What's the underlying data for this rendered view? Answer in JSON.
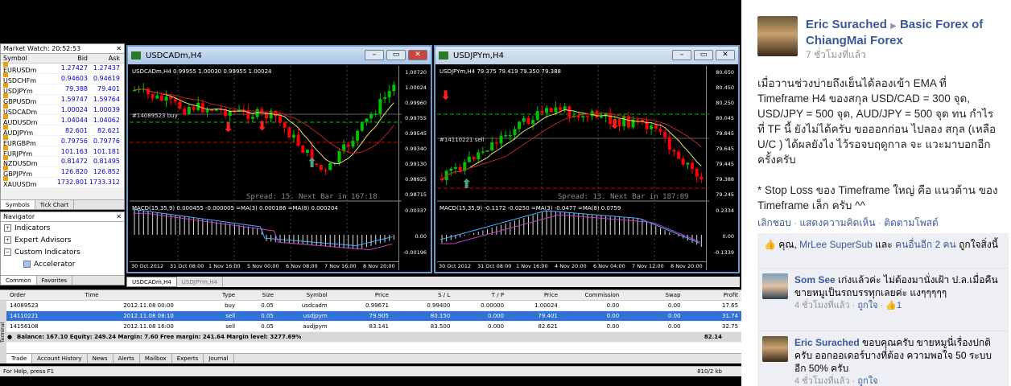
{
  "market_watch": {
    "title": "Market Watch: 20:52:53",
    "col_symbol": "Symbol",
    "col_bid": "Bid",
    "col_ask": "Ask",
    "rows": [
      {
        "symbol": "EURUSDm",
        "bid": "1.27427",
        "ask": "1.27437"
      },
      {
        "symbol": "USDCHFm",
        "bid": "0.94603",
        "ask": "0.94619"
      },
      {
        "symbol": "USDJPYm",
        "bid": "79.388",
        "ask": "79.401"
      },
      {
        "symbol": "GBPUSDm",
        "bid": "1.59747",
        "ask": "1.59764"
      },
      {
        "symbol": "USDCADm",
        "bid": "1.00024",
        "ask": "1.00039"
      },
      {
        "symbol": "AUDUSDm",
        "bid": "1.04044",
        "ask": "1.04062"
      },
      {
        "symbol": "AUDJPYm",
        "bid": "82.601",
        "ask": "82.621"
      },
      {
        "symbol": "EURGBPm",
        "bid": "0.79756",
        "ask": "0.79776"
      },
      {
        "symbol": "EURJPYm",
        "bid": "101.163",
        "ask": "101.181"
      },
      {
        "symbol": "NZDUSDm",
        "bid": "0.81472",
        "ask": "0.81495"
      },
      {
        "symbol": "GBPJPYm",
        "bid": "126.820",
        "ask": "126.852"
      },
      {
        "symbol": "XAUUSDm",
        "bid": "1732.801",
        "ask": "1733.312"
      }
    ],
    "tab_symbols": "Symbols",
    "tab_tick_chart": "Tick Chart"
  },
  "navigator": {
    "title": "Navigator",
    "items": [
      "Indicators",
      "Expert Advisors",
      "Custom Indicators",
      "Accelerator"
    ],
    "tab_common": "Common",
    "tab_favorites": "Favorites"
  },
  "chart1": {
    "window_title": "USDCADm,H4",
    "info": "USDCADm,H4  0.99955 1.00030 0.99955 1.00024",
    "order_label": "#14089523 buy",
    "spread": "Spread: 15. Next Bar in 167:18",
    "price_ticks": [
      "1.00720",
      "1.00024",
      "0.99960",
      "0.99755",
      "0.99545",
      "0.99340",
      "0.99130",
      "0.98925",
      "0.98715"
    ],
    "macd_label": "MACD(15,35,9) 0.000455 -0.000005  =MA(3) 0.000186  =MA(8) 0.000204",
    "macd_ticks": [
      "0.00337",
      "0.00",
      "-0.00196"
    ],
    "dates": [
      "30 Oct 2012",
      "31 Oct 08:00",
      "1 Nov 16:00",
      "5 Nov 00:00",
      "6 Nov 08:00",
      "7 Nov 16:00",
      "8 Nov 20:00"
    ]
  },
  "chart2": {
    "window_title": "USDJPYm,H4",
    "info": "USDJPYm,H4  79.375 79.419 79.350 79.388",
    "order_label": "#14110221 sell",
    "spread": "Spread: 13. Next Bar in 187:09",
    "price_ticks": [
      "80.650",
      "80.450",
      "80.250",
      "80.045",
      "79.845",
      "79.645",
      "79.445",
      "79.388",
      "79.245"
    ],
    "macd_label": "MACD(15,35,9) -0.1172 -0.0250  =MA(3) -0.0477  =MA(8) 0.0759",
    "macd_ticks": [
      "0.2334",
      "0.00",
      "-0.1339"
    ],
    "dates": [
      "30 Oct 2012",
      "31 Oct 08:00",
      "1 Nov 16:00",
      "4 Nov 20:00",
      "6 Nov 04:00",
      "7 Nov 12:00",
      "8 Nov 20:00"
    ]
  },
  "chart_tabs": [
    "USDCADm,H4",
    "USDJPYm,H4"
  ],
  "terminal": {
    "headers": [
      "Order",
      "Time",
      "Type",
      "Size",
      "Symbol",
      "Price",
      "S / L",
      "T / P",
      "Price",
      "Commission",
      "Swap",
      "Profit"
    ],
    "orders": [
      [
        "14089523",
        "2012.11.08 00:00",
        "buy",
        "0.05",
        "usdcadm",
        "0.99671",
        "0.99400",
        "0.00000",
        "1.00024",
        "0.00",
        "0.00",
        "17.65"
      ],
      [
        "14110221",
        "2012.11.08 08:10",
        "sell",
        "0.05",
        "usdjpym",
        "79.905",
        "80.150",
        "0.000",
        "79.401",
        "0.00",
        "0.00",
        "31.74"
      ],
      [
        "14156108",
        "2012.11.08 16:00",
        "sell",
        "0.05",
        "audjpym",
        "83.141",
        "83.500",
        "0.000",
        "82.621",
        "0.00",
        "0.00",
        "32.75"
      ]
    ],
    "balance_line": "Balance: 167.10  Equity: 249.24  Margin: 7.60  Free margin: 241.64  Margin level: 3277.69%",
    "balance_total": "82.14",
    "side_label": "Terminal",
    "tabs": [
      "Trade",
      "Account History",
      "News",
      "Alerts",
      "Mailbox",
      "Experts",
      "Journal"
    ]
  },
  "status": {
    "help": "For Help, press F1",
    "traffic": "810/2 kb"
  },
  "post": {
    "author": "Eric Surached",
    "separator": "▶",
    "group": "Basic Forex of ChiangMai Forex",
    "time": "7 ชั่วโมงที่แล้ว",
    "body1": "เมื่อวานช่วงบ่ายถึงเย็นได้ลองเข้า EMA ที่ Timeframe H4 ของสกุล USD/CAD = 300 จุด, USD/JPY = 500 จุด, AUD/JPY = 500 จุด ทน กำไรที่ TF นี้ ยังไม่ได้ครับ ขอออกก่อน ไปลอง สกุล (เหลือ U/C ) ได้ผลยังไง ไว้รอจบฤดูกาล จะ แวะมาบอกอีกครั้งครับ",
    "body2": "* Stop Loss ของ Timeframe ใหญ่ คือ แนวต้าน ของ Timeframe เล็ก ครับ ^^",
    "actions": [
      "เลิกชอบ",
      "แสดงความคิดเห็น",
      "ติดตามโพสต์"
    ],
    "likes_prefix": "คุณ, ",
    "likes_name": "MrLee SuperSub",
    "likes_and": " และ ",
    "likes_others": "คนอื่นอีก 2 คน",
    "likes_suffix": " ถูกใจสิ่งนี้"
  },
  "comments": [
    {
      "author": "Som See",
      "text": "เก่งแล้วค่ะ ไม่ต้องมานั่งเฝ้า ป.ล.เมื่อคืนขายหมูเป็นรถบรรทุกเลยค่ะ แงๆๆๆๆๆ",
      "time": "4 ชั่วโมงที่แล้ว",
      "like": "ถูกใจ",
      "count": "1"
    },
    {
      "author": "Eric Surached",
      "text": "ขอบคุณครับ ขายหมูนี่เรื่องปกติครับ ออกออเดอร์บางที่ต้อง ความพอใจ 50 ระบบ อีก 50% ครับ",
      "time": "4 ชั่วโมงที่แล้ว",
      "like": "ถูกใจ",
      "count": ""
    }
  ],
  "colors": {
    "fb_link": "#3b5998",
    "bull": "#00c000",
    "bear": "#ff0000",
    "mt4_frame": "#6f97c8"
  }
}
